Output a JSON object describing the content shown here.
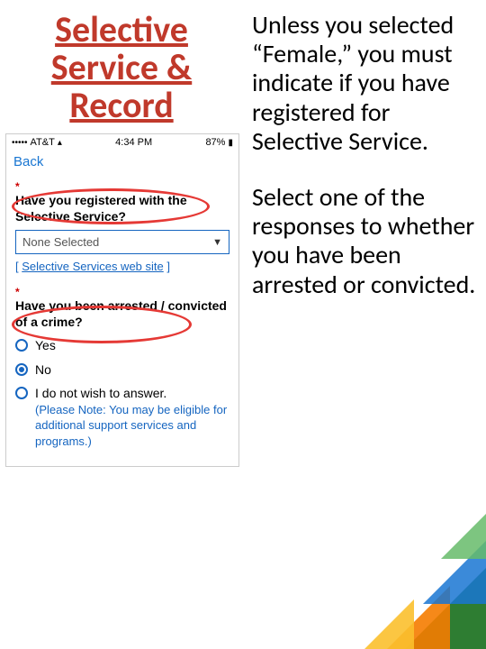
{
  "title": "Selective Service & Record",
  "right": {
    "p1": "Unless you selected “Female,” you must indicate if you have registered for Selective Service.",
    "p2": "Select one of the responses to whether you have been arrested or convicted."
  },
  "phone": {
    "carrier": "AT&T",
    "wifi": "●",
    "time": "4:34 PM",
    "battery_pct": "87%",
    "back": "Back",
    "asterisk": "*",
    "q1": "Have you registered with the Selective Service?",
    "dropdown_value": "None Selected",
    "link_text": "Selective Services web site",
    "q2": "Have you been arrested / convicted of a crime?",
    "opts": {
      "yes": "Yes",
      "no": "No",
      "na": "I do not wish to answer.",
      "na_note": "(Please Note: You may be eligible for additional support services and programs.)"
    }
  }
}
